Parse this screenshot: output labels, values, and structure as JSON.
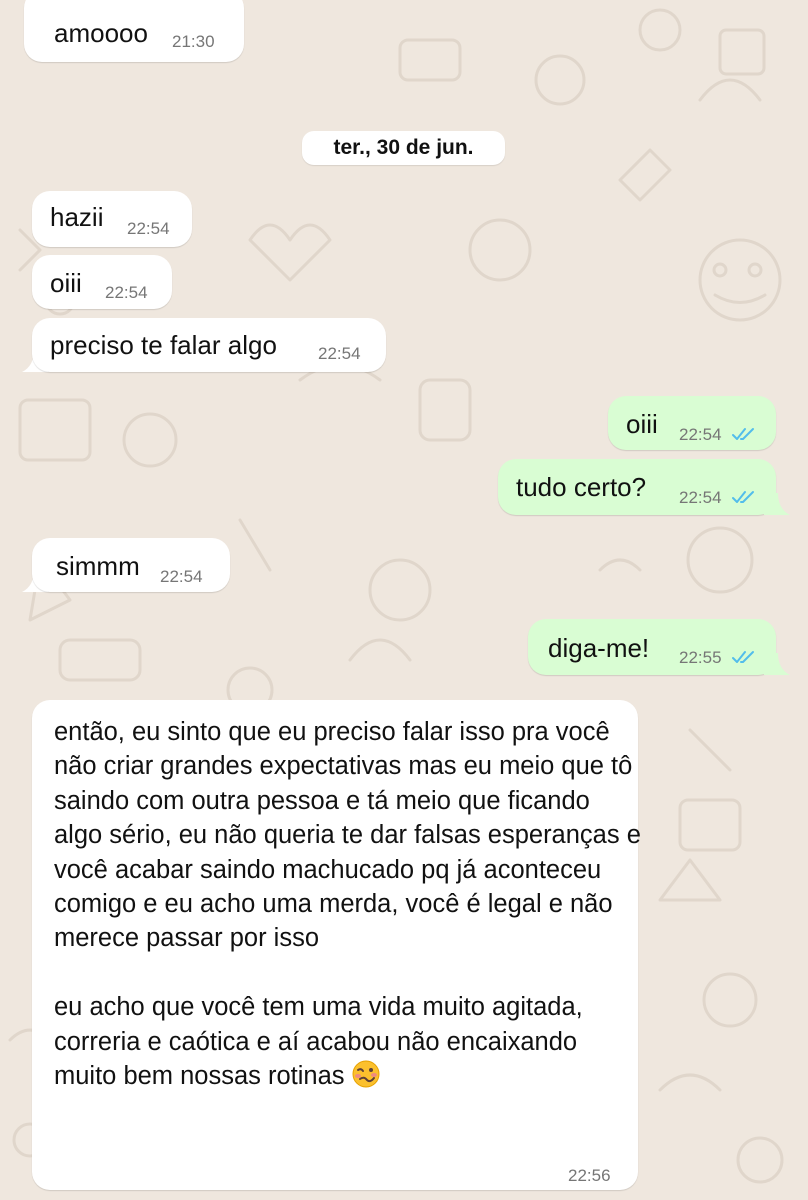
{
  "date_separator": "ter., 30 de jun.",
  "messages": [
    {
      "dir": "in",
      "text": "amoooo",
      "time": "21:30"
    },
    {
      "dir": "in",
      "text": "hazii",
      "time": "22:54"
    },
    {
      "dir": "in",
      "text": "oiii",
      "time": "22:54"
    },
    {
      "dir": "in",
      "text": "preciso te falar algo",
      "time": "22:54"
    },
    {
      "dir": "out",
      "text": "oiii",
      "time": "22:54",
      "status": "read"
    },
    {
      "dir": "out",
      "text": "tudo certo?",
      "time": "22:54",
      "status": "read"
    },
    {
      "dir": "in",
      "text": "simmm",
      "time": "22:54"
    },
    {
      "dir": "out",
      "text": "diga-me!",
      "time": "22:55",
      "status": "read"
    },
    {
      "dir": "in",
      "text": "então, eu sinto que eu preciso falar isso pra você não criar grandes expectativas mas eu meio que tô saindo com outra pessoa e tá meio que ficando algo sério, eu não queria te dar falsas esperanças e você acabar saindo machucado pq já aconteceu comigo e eu acho uma merda, você é legal e não merece passar por isso\n\neu acho que você tem uma vida muito agitada, correria e caótica e aí acabou não encaixando muito bem nossas rotinas",
      "emoji": "woozy-face",
      "time": "22:56"
    }
  ],
  "colors": {
    "wallpaper": "#efe7de",
    "incoming_bubble": "#ffffff",
    "outgoing_bubble": "#d9fdd3",
    "timestamp": "#767676",
    "read_ticks": "#53bdeb"
  }
}
